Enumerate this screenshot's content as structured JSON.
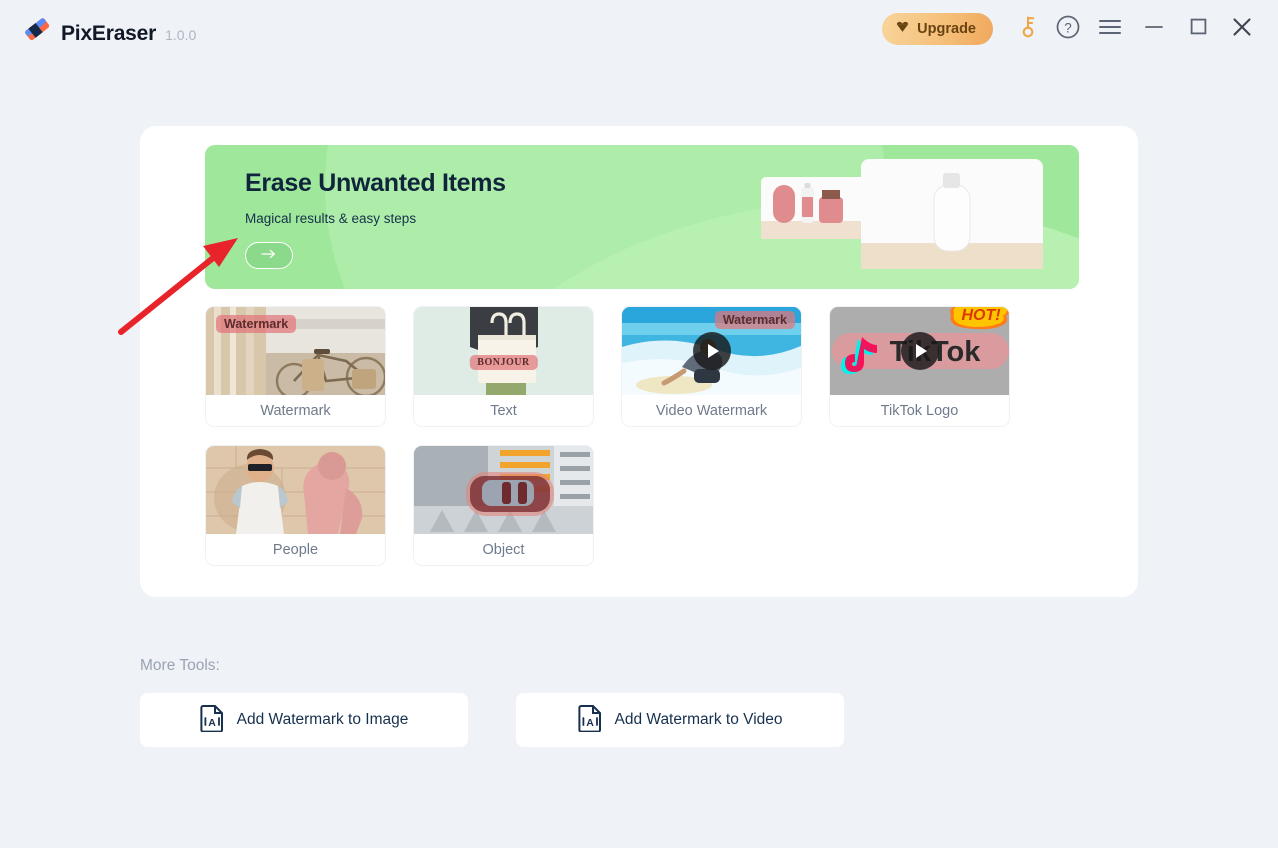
{
  "app": {
    "name": "PixEraser",
    "version": "1.0.0",
    "logo_icon": "eraser-logo-icon"
  },
  "titlebar": {
    "upgrade_label": "Upgrade",
    "upgrade_icon": "diamond-gem-icon",
    "key_icon": "key-icon",
    "help_icon": "help-circle-icon",
    "menu_icon": "hamburger-menu-icon",
    "minimize_icon": "minimize-icon",
    "maximize_icon": "maximize-icon",
    "close_icon": "close-icon",
    "colors": {
      "upgrade_start": "#f8d49a",
      "upgrade_end": "#f0a85c",
      "upgrade_text": "#6a4313",
      "key": "#f0a646",
      "window_icon": "#5b6472"
    }
  },
  "hero": {
    "title": "Erase Unwanted Items",
    "subtitle": "Magical results & easy steps",
    "cta_icon": "arrow-right-icon",
    "background_color": "#9ee79b",
    "title_color": "#10243c",
    "art": {
      "before_label": "before-preview-thumbnail",
      "after_label": "after-preview-thumbnail",
      "transform_icon": "curved-arrow-icon"
    }
  },
  "tools": [
    {
      "id": "watermark",
      "label": "Watermark",
      "thumb": "bicycle-photo",
      "overlay_text": "Watermark",
      "has_play": false,
      "hot": false
    },
    {
      "id": "text",
      "label": "Text",
      "thumb": "tote-bag-photo",
      "overlay_text": "BONJOUR",
      "has_play": false,
      "hot": false
    },
    {
      "id": "video-watermark",
      "label": "Video Watermark",
      "thumb": "surfer-photo",
      "overlay_text": "Watermark",
      "has_play": true,
      "hot": false
    },
    {
      "id": "tiktok-logo",
      "label": "TikTok Logo",
      "thumb": "tiktok-logo-photo",
      "overlay_text": "TikTok",
      "has_play": true,
      "hot": true,
      "hot_label": "HOT!"
    },
    {
      "id": "people",
      "label": "People",
      "thumb": "man-sunglasses-photo",
      "overlay_text": "",
      "has_play": false,
      "hot": false
    },
    {
      "id": "object",
      "label": "Object",
      "thumb": "aerial-car-photo",
      "overlay_text": "",
      "has_play": false,
      "hot": false
    }
  ],
  "more_tools": {
    "heading": "More Tools:",
    "items": [
      {
        "id": "add-watermark-image",
        "label": "Add Watermark to Image",
        "icon": "document-text-icon"
      },
      {
        "id": "add-watermark-video",
        "label": "Add Watermark to Video",
        "icon": "document-text-icon"
      }
    ]
  },
  "annotation": {
    "arrow_icon": "red-pointer-arrow",
    "color": "#e8242a"
  }
}
